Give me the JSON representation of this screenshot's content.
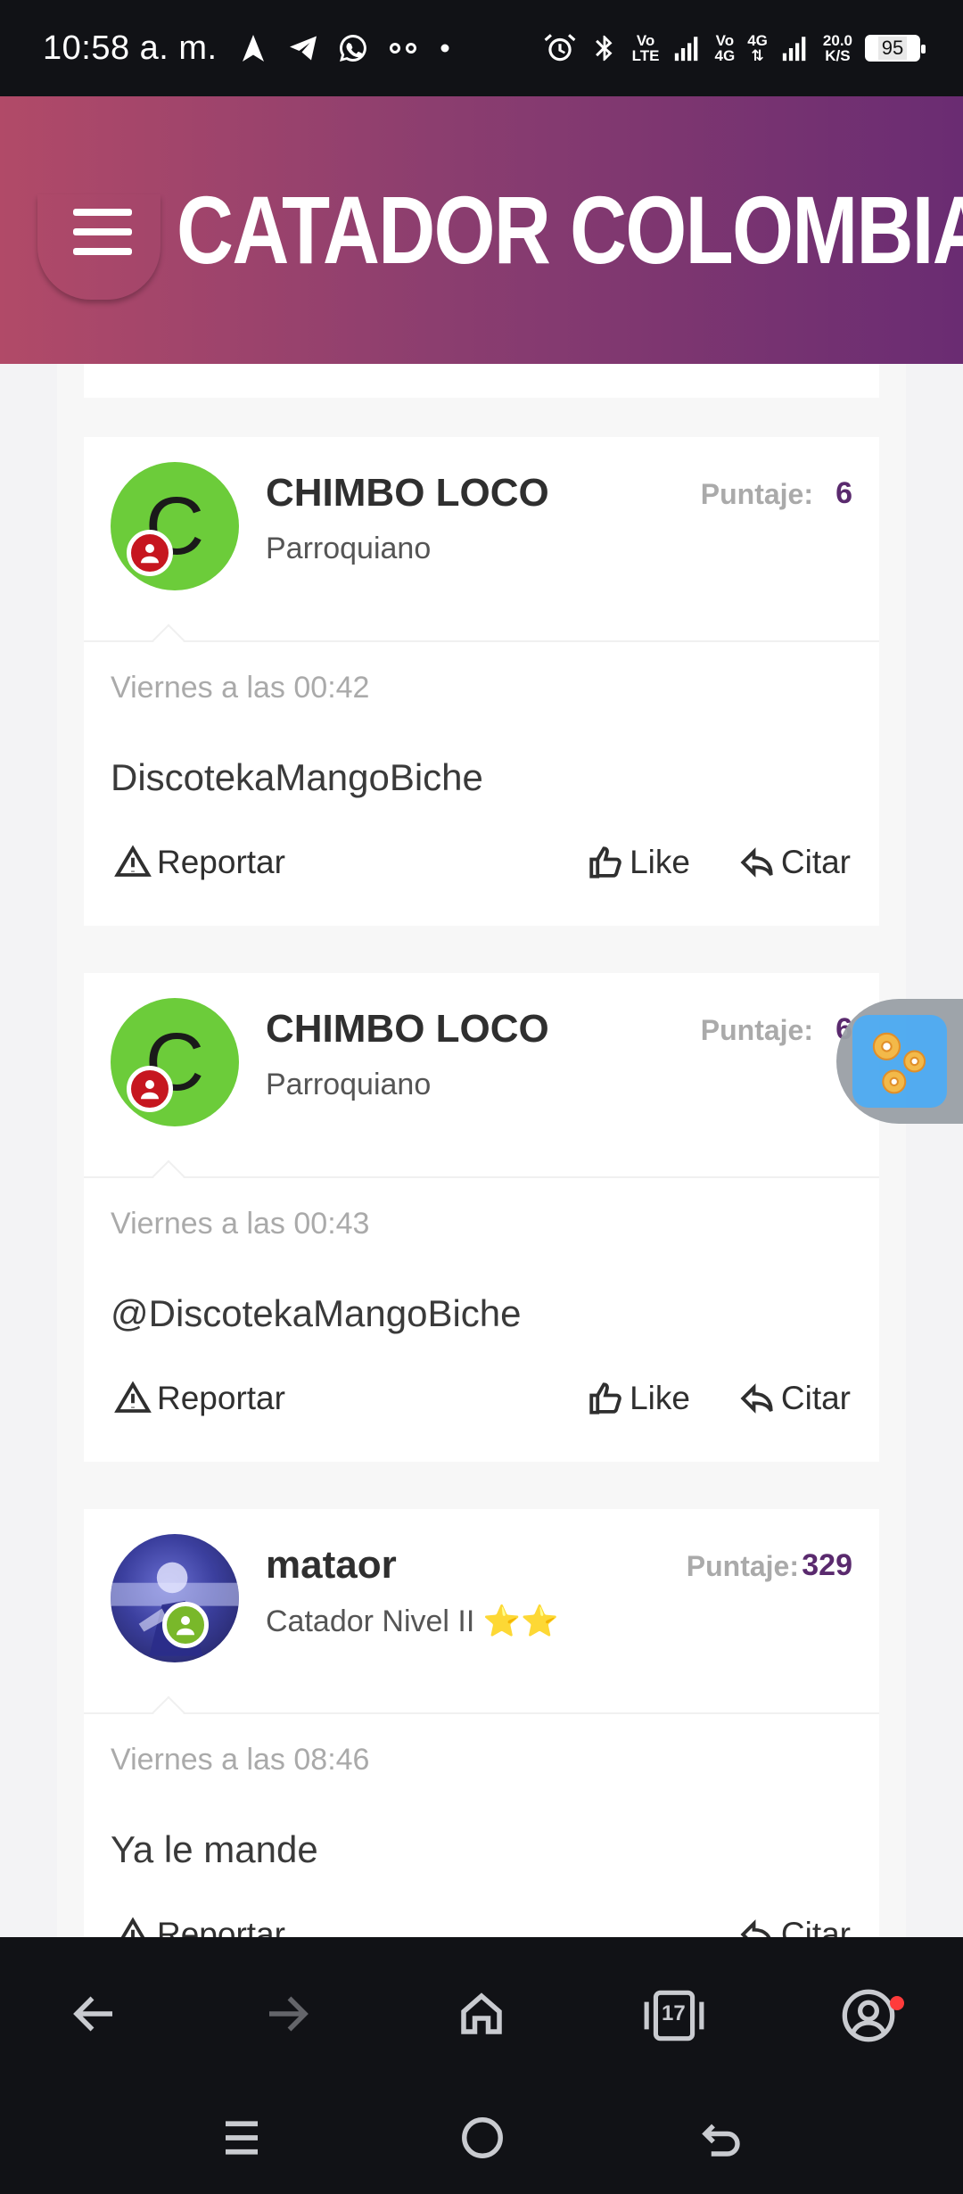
{
  "status_bar": {
    "time": "10:58 a. m.",
    "net_top": "Vo",
    "net_bottom": "LTE",
    "net2_top": "Vo",
    "net2_bottom": "4G",
    "net3_top": "4G",
    "speed_top": "20.0",
    "speed_bottom": "K/S",
    "battery": "95"
  },
  "header": {
    "title": "CATADOR COLOMBIA",
    "gradient": [
      "#b14a68",
      "#6a2c72"
    ]
  },
  "posts": [
    {
      "username": "CHIMBO LOCO",
      "rank": "Parroquiano",
      "avatar_letter": "C",
      "score_label": "Puntaje:",
      "score": "6",
      "date": "Viernes a las 00:42",
      "message": "DiscotekaMangoBiche",
      "report_label": "Reportar",
      "like_label": "Like",
      "quote_label": "Citar"
    },
    {
      "username": "CHIMBO LOCO",
      "rank": "Parroquiano",
      "avatar_letter": "C",
      "score_label": "Puntaje:",
      "score": "6",
      "date": "Viernes a las 00:43",
      "message": "@DiscotekaMangoBiche",
      "report_label": "Reportar",
      "like_label": "Like",
      "quote_label": "Citar"
    },
    {
      "username": "mataor",
      "rank": "Catador Nivel II ⭐⭐",
      "score_label": "Puntaje:",
      "score": "329",
      "date": "Viernes a las 08:46",
      "message": "Ya le mande",
      "report_label": "Reportar",
      "quote_label": "Citar"
    }
  ],
  "bottom_nav": {
    "tabs_count": "17"
  },
  "colors": {
    "accent_score": "#5a2a6e",
    "avatar_green": "#6ccc3a",
    "badge_red": "#c6161f",
    "badge_green": "#79b82a"
  }
}
